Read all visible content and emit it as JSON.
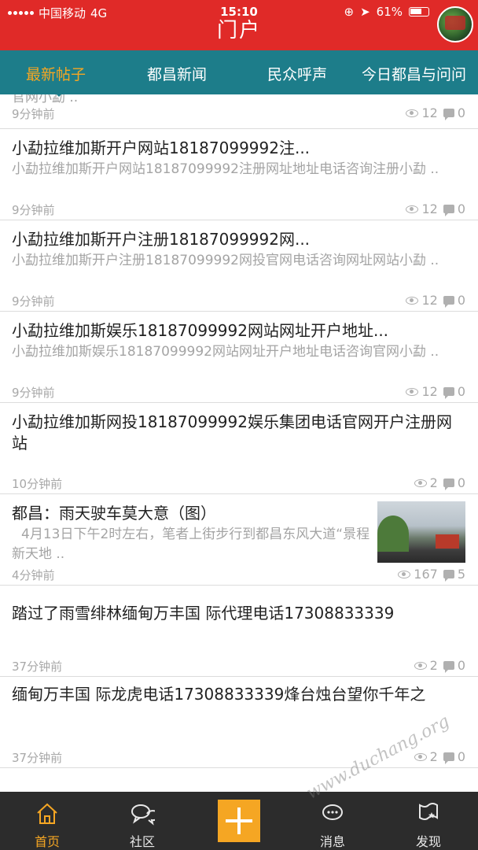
{
  "status_bar": {
    "carrier": "中国移动",
    "network": "4G",
    "time": "15:10",
    "battery": "61%"
  },
  "header": {
    "title": "门户"
  },
  "tabs": [
    {
      "label": "最新帖子",
      "active": true
    },
    {
      "label": "都昌新闻",
      "active": false
    },
    {
      "label": "民众呼声",
      "active": false
    },
    {
      "label": "今日都昌与问问",
      "active": false
    }
  ],
  "posts": [
    {
      "title": "",
      "excerpt": "官网小勐 ..",
      "time": "9分钟前",
      "views": "12",
      "comments": "0"
    },
    {
      "title": "小勐拉维加斯开户网站18187099992注...",
      "excerpt": "小勐拉维加斯开户网站18187099992注册网址地址电话咨询注册小勐 ..",
      "time": "9分钟前",
      "views": "12",
      "comments": "0"
    },
    {
      "title": "小勐拉维加斯开户注册18187099992网...",
      "excerpt": "小勐拉维加斯开户注册18187099992网投官网电话咨询网址网站小勐 ..",
      "time": "9分钟前",
      "views": "12",
      "comments": "0"
    },
    {
      "title": "小勐拉维加斯娱乐18187099992网站网址开户地址...",
      "excerpt": "小勐拉维加斯娱乐18187099992网站网址开户地址电话咨询官网小勐 ..",
      "time": "9分钟前",
      "views": "12",
      "comments": "0"
    },
    {
      "title": "小勐拉维加斯网投18187099992娱乐集团电话官网开户注册网站",
      "excerpt": "",
      "time": "10分钟前",
      "views": "2",
      "comments": "0"
    },
    {
      "title": "都昌：雨天驶车莫大意（图）",
      "excerpt": "4月13日下午2时左右，笔者上街步行到都昌东风大道“景程新天地 ..",
      "time": "4分钟前",
      "views": "167",
      "comments": "5"
    },
    {
      "title": "踏过了雨雪绯林缅甸万丰国 际代理电话17308833339",
      "excerpt": "",
      "time": "37分钟前",
      "views": "2",
      "comments": "0"
    },
    {
      "title": "缅甸万丰国 际龙虎电话17308833339烽台烛台望你千年之",
      "excerpt": "",
      "time": "37分钟前",
      "views": "2",
      "comments": "0"
    }
  ],
  "bottom_nav": [
    {
      "label": "首页",
      "icon": "home-icon",
      "active": true
    },
    {
      "label": "社区",
      "icon": "chat-bubbles-icon",
      "active": false
    },
    {
      "label": "",
      "icon": "plus-icon",
      "active": false
    },
    {
      "label": "消息",
      "icon": "message-icon",
      "active": false
    },
    {
      "label": "发现",
      "icon": "discover-flag-icon",
      "active": false
    }
  ],
  "watermark": "www.duchang.org",
  "colors": {
    "header": "#e02a28",
    "tabbar": "#1d7d8a",
    "accent": "#f5a623",
    "bottom": "#2c2c2c"
  }
}
